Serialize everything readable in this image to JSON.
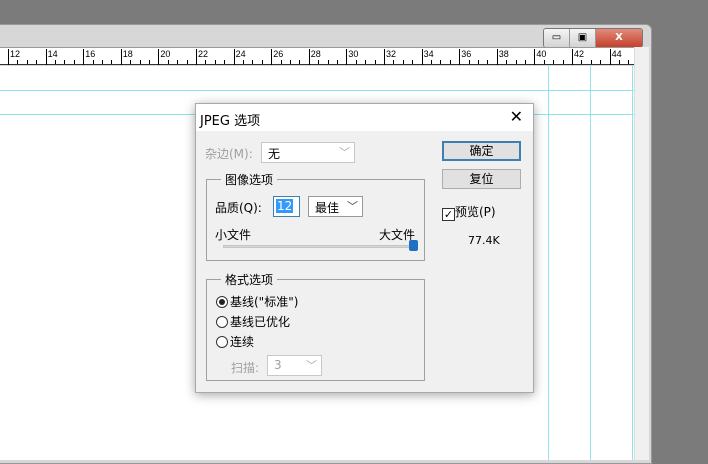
{
  "window": {
    "minimize": "▭",
    "maximize": "▣",
    "close": "X"
  },
  "ruler": {
    "labels": [
      "12",
      "14",
      "16",
      "18",
      "20",
      "22",
      "24",
      "26",
      "28",
      "30",
      "32",
      "34",
      "36",
      "38",
      "40",
      "42",
      "44"
    ]
  },
  "dialog": {
    "title": "JPEG 选项",
    "close": "✕",
    "matte": {
      "label": "杂边(M):",
      "value": "无"
    },
    "image_options": {
      "title": "图像选项",
      "quality_label": "品质(Q):",
      "quality_value": "12",
      "quality_preset": "最佳",
      "small_file": "小文件",
      "large_file": "大文件",
      "slider_value": 12,
      "slider_max": 12
    },
    "format_options": {
      "title": "格式选项",
      "options": [
        {
          "label": "基线(\"标准\")",
          "selected": true
        },
        {
          "label": "基线已优化",
          "selected": false
        },
        {
          "label": "连续",
          "selected": false
        }
      ],
      "scan_label": "扫描:",
      "scan_value": "3"
    },
    "ok": "确定",
    "reset": "复位",
    "preview": {
      "label": "预览(P)",
      "checked": true
    },
    "file_size": "77.4K"
  }
}
